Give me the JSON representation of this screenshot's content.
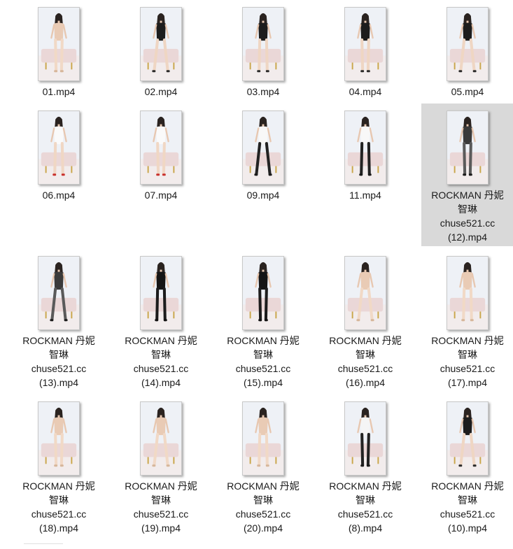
{
  "colors": {
    "selected_bg": "#d9d9d9",
    "thumb_border": "#c8c8c8",
    "text": "#1a1a1a"
  },
  "files": [
    {
      "id": "f01",
      "lines": [
        "01.mp4"
      ],
      "selected": false,
      "outfit": "nude-tone"
    },
    {
      "id": "f02",
      "lines": [
        "02.mp4"
      ],
      "selected": false,
      "outfit": "black-lingerie"
    },
    {
      "id": "f03",
      "lines": [
        "03.mp4"
      ],
      "selected": false,
      "outfit": "black-lingerie"
    },
    {
      "id": "f04",
      "lines": [
        "04.mp4"
      ],
      "selected": false,
      "outfit": "black-lingerie"
    },
    {
      "id": "f05",
      "lines": [
        "05.mp4"
      ],
      "selected": false,
      "outfit": "black-lingerie"
    },
    {
      "id": "f06",
      "lines": [
        "06.mp4"
      ],
      "selected": false,
      "outfit": "white-uniform"
    },
    {
      "id": "f07",
      "lines": [
        "07.mp4"
      ],
      "selected": false,
      "outfit": "white-uniform"
    },
    {
      "id": "f09",
      "lines": [
        "09.mp4"
      ],
      "selected": false,
      "outfit": "black-stockings"
    },
    {
      "id": "f11",
      "lines": [
        "11.mp4"
      ],
      "selected": false,
      "outfit": "black-stockings"
    },
    {
      "id": "f12",
      "lines": [
        "ROCKMAN 丹妮",
        "智琳",
        "chuse521.cc",
        "(12).mp4"
      ],
      "selected": true,
      "outfit": "fishnet"
    },
    {
      "id": "f13",
      "lines": [
        "ROCKMAN 丹妮",
        "智琳",
        "chuse521.cc",
        "(13).mp4"
      ],
      "selected": false,
      "outfit": "fishnet"
    },
    {
      "id": "f14",
      "lines": [
        "ROCKMAN 丹妮",
        "智琳",
        "chuse521.cc",
        "(14).mp4"
      ],
      "selected": false,
      "outfit": "black-bodysuit"
    },
    {
      "id": "f15",
      "lines": [
        "ROCKMAN 丹妮",
        "智琳",
        "chuse521.cc",
        "(15).mp4"
      ],
      "selected": false,
      "outfit": "black-bodysuit"
    },
    {
      "id": "f16",
      "lines": [
        "ROCKMAN 丹妮",
        "智琳",
        "chuse521.cc",
        "(16).mp4"
      ],
      "selected": false,
      "outfit": "nude-tone"
    },
    {
      "id": "f17",
      "lines": [
        "ROCKMAN 丹妮",
        "智琳",
        "chuse521.cc",
        "(17).mp4"
      ],
      "selected": false,
      "outfit": "nude-tone"
    },
    {
      "id": "f18",
      "lines": [
        "ROCKMAN 丹妮",
        "智琳",
        "chuse521.cc",
        "(18).mp4"
      ],
      "selected": false,
      "outfit": "nude-tone"
    },
    {
      "id": "f19",
      "lines": [
        "ROCKMAN 丹妮",
        "智琳",
        "chuse521.cc",
        "(19).mp4"
      ],
      "selected": false,
      "outfit": "nude-tone"
    },
    {
      "id": "f20",
      "lines": [
        "ROCKMAN 丹妮",
        "智琳",
        "chuse521.cc",
        "(20).mp4"
      ],
      "selected": false,
      "outfit": "nude-tone"
    },
    {
      "id": "f08",
      "lines": [
        "ROCKMAN 丹妮",
        "智琳",
        "chuse521.cc",
        "(8).mp4"
      ],
      "selected": false,
      "outfit": "white-top-black-skirt"
    },
    {
      "id": "f10",
      "lines": [
        "ROCKMAN 丹妮",
        "智琳",
        "chuse521.cc",
        "(10).mp4"
      ],
      "selected": false,
      "outfit": "black-lingerie"
    }
  ]
}
